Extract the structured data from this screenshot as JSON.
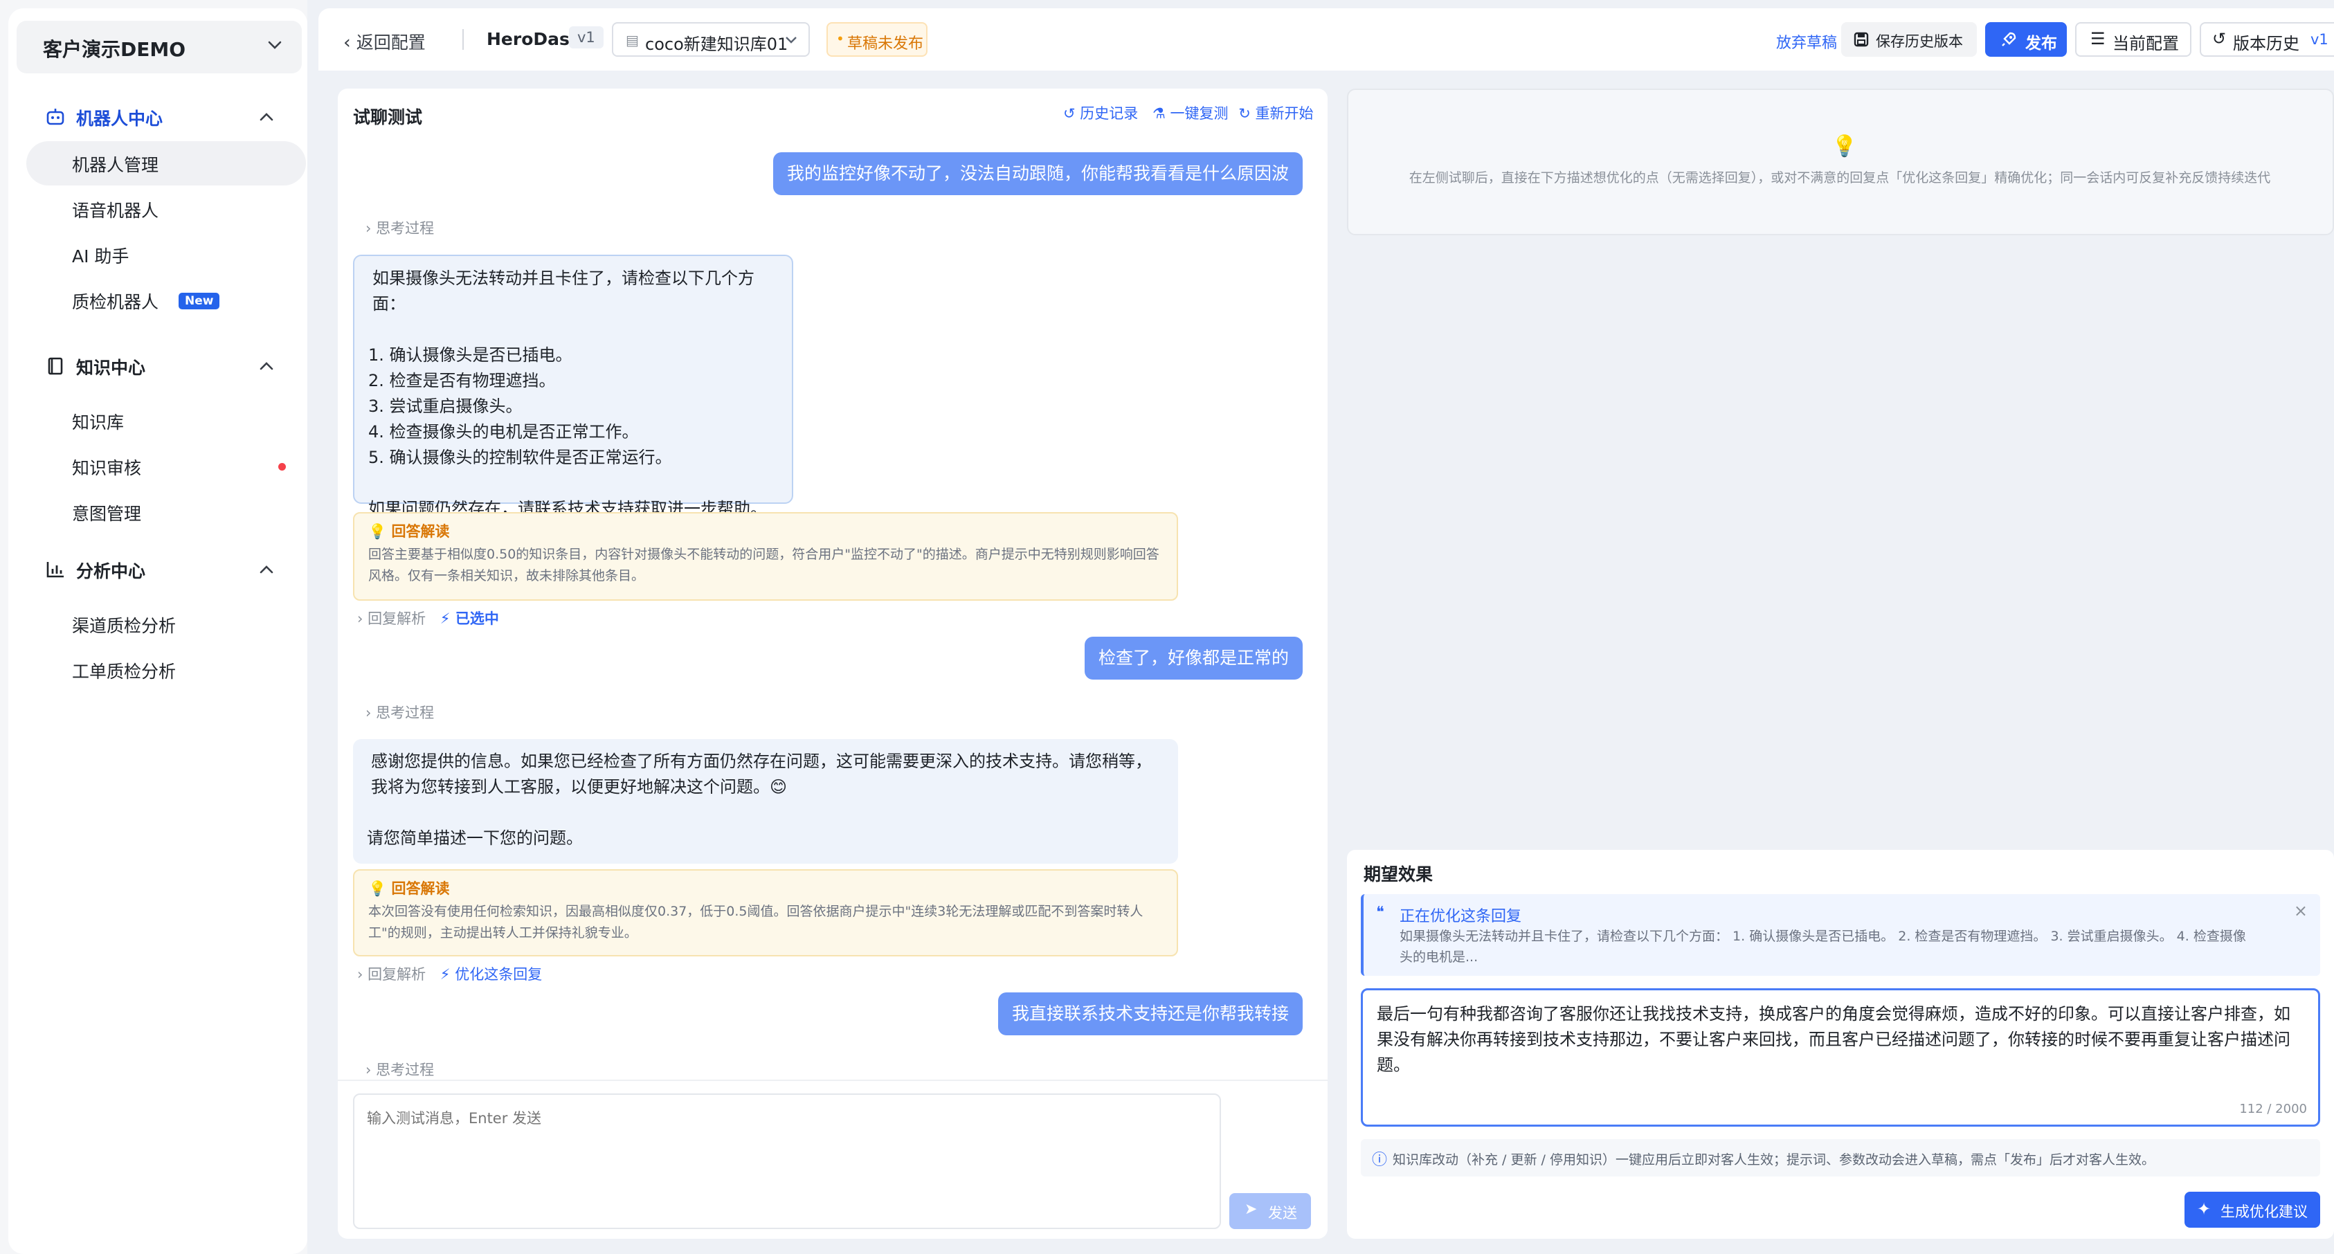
{
  "sidebar": {
    "org_name": "客户演示DEMO",
    "groups": [
      {
        "label": "机器人中心",
        "items": [
          {
            "label": "机器人管理"
          },
          {
            "label": "语音机器人"
          },
          {
            "label": "AI 助手"
          },
          {
            "label": "质检机器人",
            "badge": "New"
          }
        ]
      },
      {
        "label": "知识中心",
        "items": [
          {
            "label": "知识库"
          },
          {
            "label": "知识审核"
          },
          {
            "label": "意图管理"
          }
        ]
      },
      {
        "label": "分析中心",
        "items": [
          {
            "label": "渠道质检分析"
          },
          {
            "label": "工单质检分析"
          }
        ]
      }
    ]
  },
  "topbar": {
    "back_label": "返回配置",
    "bot_name": "HeroDash",
    "version": "v1",
    "kb_select": "coco新建知识库01",
    "draft_status": "草稿未发布",
    "discard_label": "放弃草稿",
    "save_history_label": "保存历史版本",
    "publish_label": "发布",
    "current_config_label": "当前配置",
    "version_history_label": "版本历史",
    "version_history_badge": "v1"
  },
  "chat": {
    "title": "试聊测试",
    "history_label": "历史记录",
    "one_click_copy_label": "一键复测",
    "restart_label": "重新开始",
    "think_label": "思考过程",
    "user_msg_1": "我的监控好像不动了，没法自动跟随，你能帮我看看是什么原因波",
    "answer_1": {
      "line1": "如果摄像头无法转动并且卡住了，请检查以下几个方面：",
      "items": [
        "1. 确认摄像头是否已插电。",
        "2. 检查是否有物理遮挡。",
        "3. 尝试重启摄像头。",
        "4. 检查摄像头的电机是否正常工作。",
        "5. 确认摄像头的控制软件是否正常运行。"
      ],
      "closing": "如果问题仍然存在，请联系技术支持获取进一步帮助。😊"
    },
    "interp_title": "回答解读",
    "interp_1": "回答主要基于相似度0.50的知识条目，内容针对摄像头不能转动的问题，符合用户\"监控不动了\"的描述。商户提示中无特别规则影响回答风格。仅有一条相关知识，故未排除其他条目。",
    "reply_analysis_label": "回复解析",
    "selected_label": "已选中",
    "user_msg_2": "检查了，好像都是正常的",
    "answer_2": {
      "line1": "感谢您提供的信息。如果您已经检查了所有方面仍然存在问题，这可能需要更深入的技术支持。请您稍等，我将为您转接到人工客服，以便更好地解决这个问题。😊",
      "line2": "请您简单描述一下您的问题。"
    },
    "interp_2": "本次回答没有使用任何检索知识，因最高相似度仅0.37，低于0.5阈值。回答依据商户提示中\"连续3轮无法理解或匹配不到答案时转人工\"的规则，主动提出转人工并保持礼貌专业。",
    "optimize_label": "优化这条回复",
    "user_msg_3": "我直接联系技术支持还是你帮我转接",
    "input_placeholder": "输入测试消息，Enter 发送",
    "send_label": "发送"
  },
  "right": {
    "hint_text": "在左侧试聊后，直接在下方描述想优化的点（无需选择回复），或对不满意的回复点「优化这条回复」精确优化；同一会话内可反复补充反馈持续迭代",
    "expect_title": "期望效果",
    "optimizing_title": "正在优化这条回复",
    "optimizing_snippet": "如果摄像头无法转动并且卡住了，请检查以下几个方面： 1. 确认摄像头是否已插电。 2. 检查是否有物理遮挡。 3. 尝试重启摄像头。 4. 检查摄像头的电机是...",
    "feedback_text": "最后一句有种我都咨询了客服你还让我找技术支持，换成客户的角度会觉得麻烦，造成不好的印象。可以直接让客户排查，如果没有解决你再转接到技术支持那边，不要让客户来回找，而且客户已经描述问题了，你转接的时候不要再重复让客户描述问题。",
    "char_count": "112 / 2000",
    "info_text": "知识库改动（补充 / 更新 / 停用知识）一键应用后立即对客人生效；提示词、参数改动会进入草稿，需点「发布」后才对客人生效。",
    "generate_label": "生成优化建议"
  },
  "colors": {
    "brand": "#2f66f5",
    "user_bubble": "#6b96f7",
    "warning": "#d97706",
    "badge_red": "#f5414a"
  }
}
